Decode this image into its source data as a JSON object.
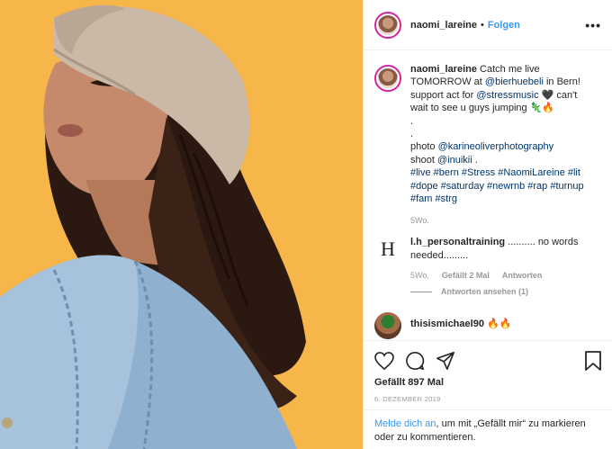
{
  "post": {
    "username": "naomi_lareine",
    "separator": "•",
    "follow_label": "Folgen",
    "more_icon": "more-options-icon",
    "more_label": "•••"
  },
  "caption": {
    "username": "naomi_lareine",
    "t1": " Catch me live TOMORROW at ",
    "mention1": "@bierhuebeli",
    "t2": " in Bern! support act for ",
    "mention2": "@stressmusic",
    "t3": " 🖤 can't wait to see u guys jumping 🦎🔥",
    "dot1": ".",
    "dot2": ".",
    "t4": "photo ",
    "mention3": "@karineoliverphotography",
    "t5": "shoot ",
    "mention4": "@inuikii",
    "t6": " .",
    "hashtags": "#live #bern #Stress #NaomiLareine #lit #dope #saturday #newrnb #rap #turnup #fam #strg",
    "time": "5Wo."
  },
  "comment1": {
    "avatar_letter": "H",
    "username": "l.h_personaltraining",
    "text": " .......... no words needed.........",
    "time": "5Wo.",
    "likes": "Gefällt 2 Mal",
    "reply": "Antworten",
    "view_replies": "Antworten ansehen (1)"
  },
  "comment2": {
    "username": "thisismichael90",
    "text": " 🔥🔥"
  },
  "actions": {
    "like_icon": "heart-icon",
    "comment_icon": "comment-icon",
    "share_icon": "share-icon",
    "save_icon": "bookmark-icon",
    "likes": "Gefällt 897 Mal",
    "date": "6. DEZEMBER 2019"
  },
  "login": {
    "link": "Melde dich an",
    "rest": ", um mit „Gefällt mir“ zu markieren oder zu kommentieren."
  },
  "colors": {
    "background": "#f7b64a",
    "link": "#3897f0",
    "mention": "#003569"
  }
}
